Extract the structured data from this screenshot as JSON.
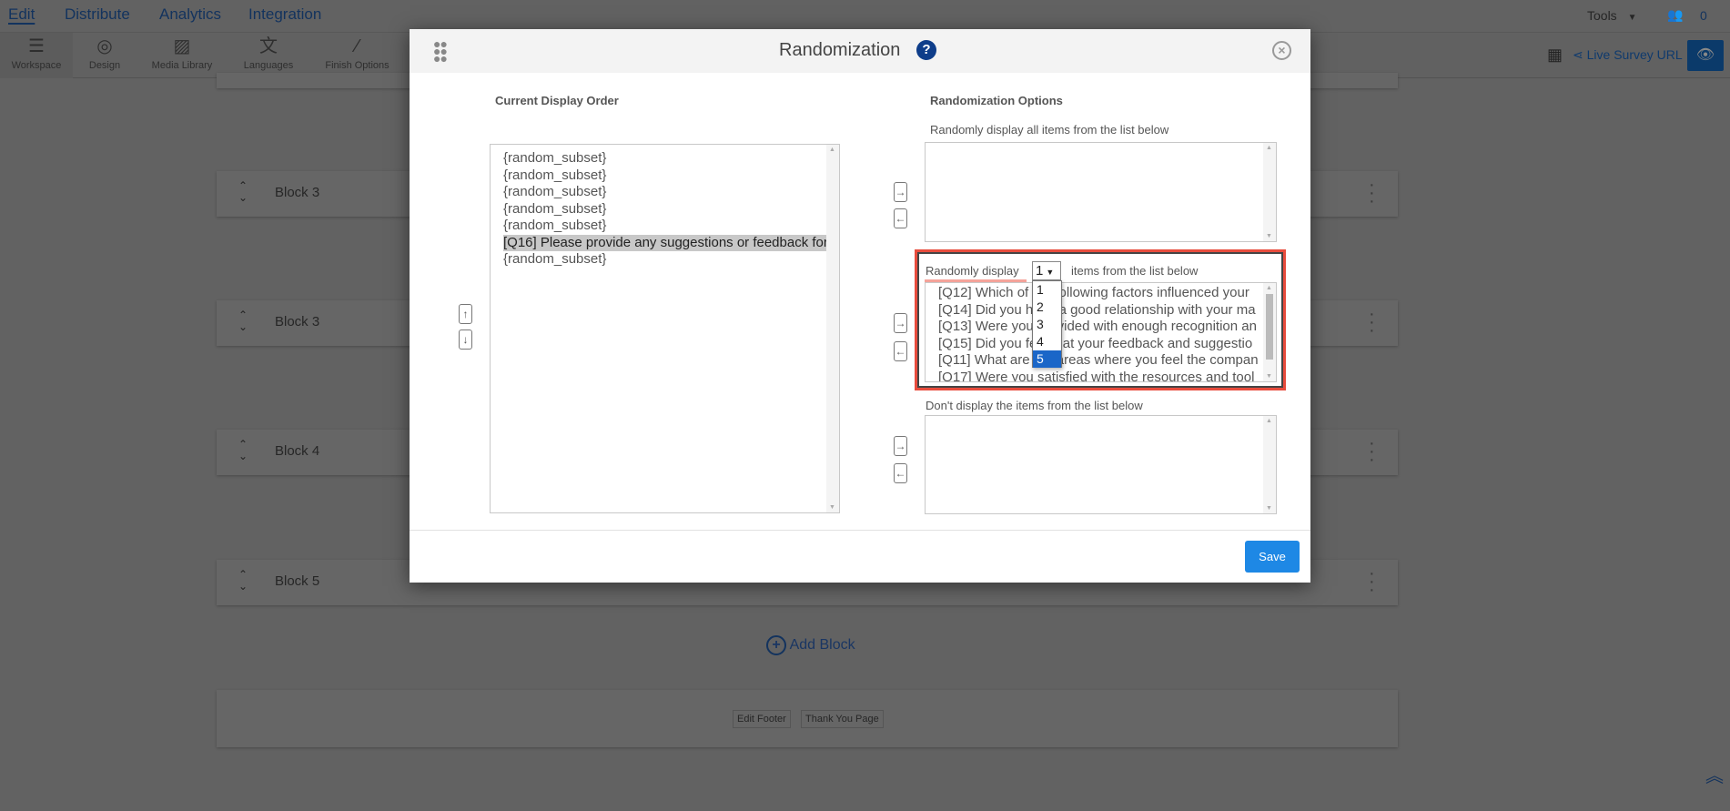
{
  "nav": {
    "tabs": [
      "Edit",
      "Distribute",
      "Analytics",
      "Integration"
    ],
    "active": "Edit",
    "tools": "Tools",
    "collab_count": "0"
  },
  "toolbar": {
    "items": [
      {
        "label": "Workspace",
        "icon": "workspace-icon"
      },
      {
        "label": "Design",
        "icon": "palette-icon"
      },
      {
        "label": "Media Library",
        "icon": "image-icon"
      },
      {
        "label": "Languages",
        "icon": "translate-icon"
      },
      {
        "label": "Finish Options",
        "icon": "magic-wand-icon"
      }
    ],
    "live_url": "Live Survey URL"
  },
  "blocks": [
    "Block 3",
    "Block 3",
    "Block 4",
    "Block 5"
  ],
  "add_block": "Add Block",
  "footer": {
    "edit_footer": "Edit Footer",
    "thank_you": "Thank You Page"
  },
  "dialog": {
    "title": "Randomization",
    "current_order_heading": "Current Display Order",
    "current_order": [
      "{random_subset}",
      "{random_subset}",
      "{random_subset}",
      "{random_subset}",
      "{random_subset}",
      "[Q16] Please provide any suggestions or feedback for",
      "{random_subset}"
    ],
    "selected_item": "[Q16] Please provide any suggestions or feedback for",
    "options_heading": "Randomization Options",
    "all_label": "Randomly display all items from the list below",
    "subset_label_pre": "Randomly display",
    "subset_count": "1",
    "subset_label_post": "items from the list below",
    "subset_options": [
      "1",
      "2",
      "3",
      "4",
      "5"
    ],
    "subset_highlighted": "5",
    "subset_items": [
      "[Q12] Which of the following factors influenced your",
      "[Q14] Did you have a good relationship with your ma",
      "[Q13] Were you provided with enough recognition an",
      "[Q15] Did you feel that your feedback and suggestio",
      "[Q11] What are the areas where you feel the compan",
      "[Q17] Were you satisfied with the resources and tool"
    ],
    "exclude_label": "Don't display the items from the list below",
    "save": "Save"
  },
  "colors": {
    "accent": "#1e88e5",
    "nav": "#1d4e89",
    "highlight": "#e84c3d",
    "dropdown_selected": "#1a66c8"
  }
}
